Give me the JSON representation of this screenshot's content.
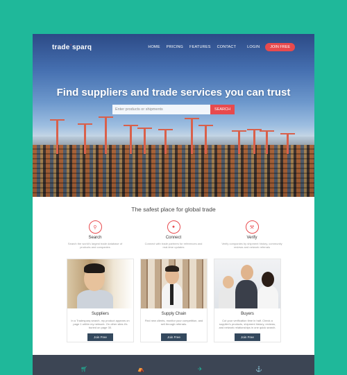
{
  "brand": {
    "name_part1": "trade",
    "name_part2": "sparq",
    "accent": "#e84a4d",
    "background": "#1fb89a"
  },
  "nav": {
    "items": [
      "HOME",
      "PRICING",
      "FEATURES",
      "CONTACT"
    ],
    "login": "LOGIN",
    "join": "JOIN FREE"
  },
  "hero": {
    "title": "Find suppliers and trade services you can trust",
    "search_placeholder": "Enter products or shipments",
    "search_button": "SEARCH"
  },
  "tagline": {
    "part1": "The safest place",
    "part2": "for global trade"
  },
  "features": [
    {
      "icon": "search-icon",
      "title": "Search",
      "desc": "Search the world's largest trade database of products and companies"
    },
    {
      "icon": "user-icon",
      "title": "Connect",
      "desc": "Connect with trade partners for references and real-time updates"
    },
    {
      "icon": "gavel-icon",
      "title": "Verify",
      "desc": "Verify companies by shipment history, community reviews and network referrals"
    }
  ],
  "cards": [
    {
      "title": "Suppliers",
      "desc": "In a Tradesparq search, my product appears on page 1 within my network. On other sites it's buried on page 30.",
      "button": "Join Free"
    },
    {
      "title": "Supply Chain",
      "desc": "Find new clients, monitor your competition, and sell through referrals.",
      "button": "Join Free"
    },
    {
      "title": "Buyers",
      "desc": "Cut your verification time in half. Check a supplier's products, shipment history, reviews, and network relationships in one quick search.",
      "button": "Join Free"
    }
  ],
  "footer": {
    "icons": [
      "cart-icon",
      "ship-icon",
      "plane-icon",
      "anchor-icon"
    ]
  }
}
